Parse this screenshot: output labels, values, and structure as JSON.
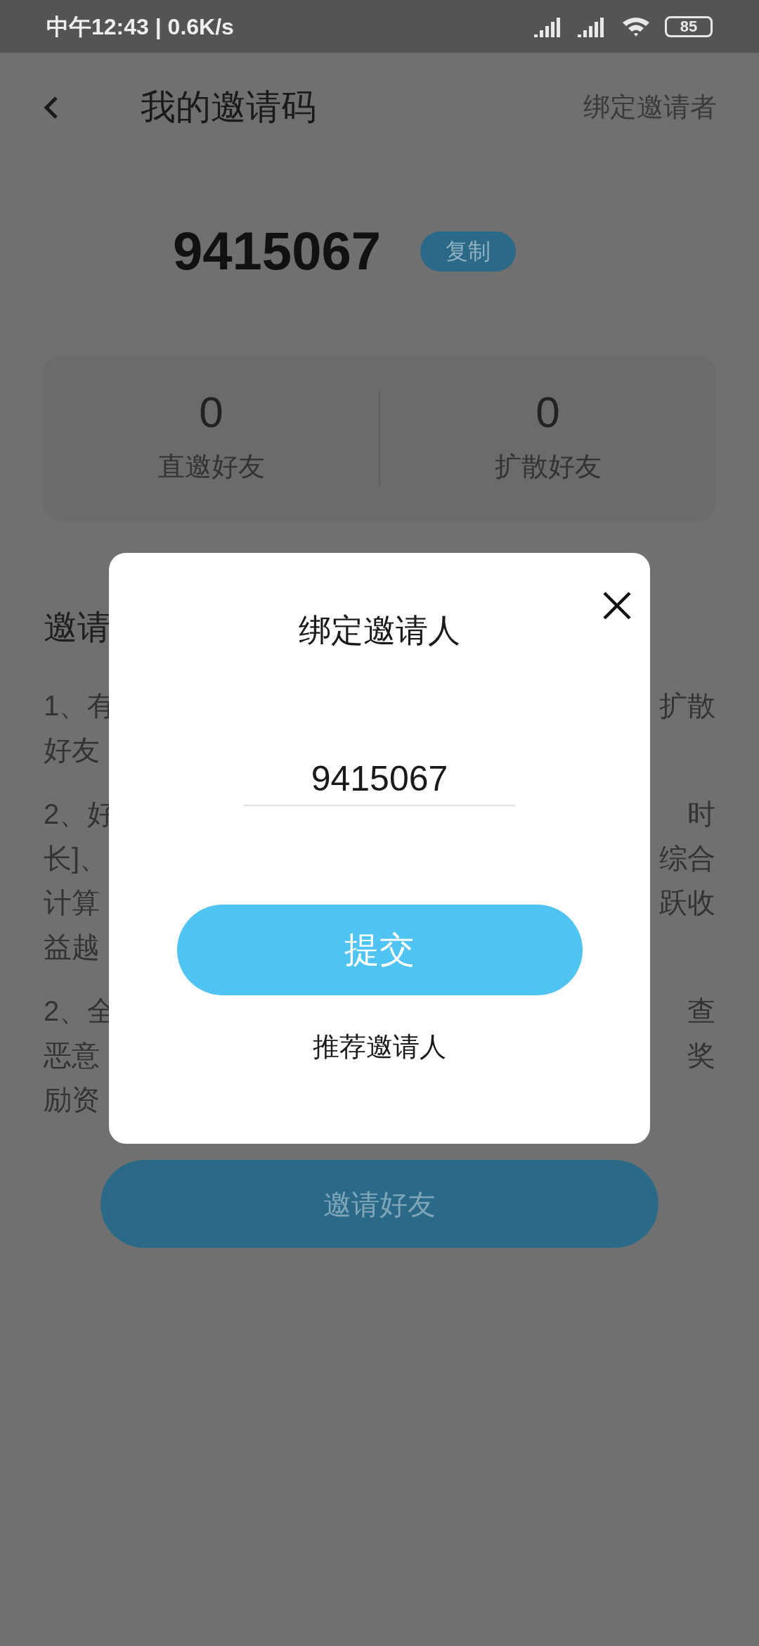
{
  "status_bar": {
    "time": "中午12:43 | 0.6K/s",
    "battery": "85"
  },
  "header": {
    "title": "我的邀请码",
    "action": "绑定邀请者"
  },
  "invite_code": {
    "value": "9415067",
    "copy_label": "复制"
  },
  "stats": [
    {
      "value": "0",
      "label": "直邀好友"
    },
    {
      "value": "0",
      "label": "扩散好友"
    }
  ],
  "rules": {
    "title": "邀请",
    "paragraphs": [
      [
        {
          "left": "1、有",
          "right": "扩散"
        },
        {
          "left": "好友"
        }
      ],
      [
        {
          "left": "2、好",
          "right": "时"
        },
        {
          "left": "长]、",
          "right": "综合"
        },
        {
          "left": "计算",
          "right": "跃收"
        },
        {
          "left": "益越"
        }
      ],
      [
        {
          "left": "2、全",
          "right": "查"
        },
        {
          "left": "恶意",
          "right": "奖"
        },
        {
          "left": "励资"
        }
      ]
    ]
  },
  "invite_button": "邀请好友",
  "dialog": {
    "title": "绑定邀请人",
    "input": {
      "value": "9415067"
    },
    "submit": "提交",
    "recommend": "推荐邀请人"
  }
}
